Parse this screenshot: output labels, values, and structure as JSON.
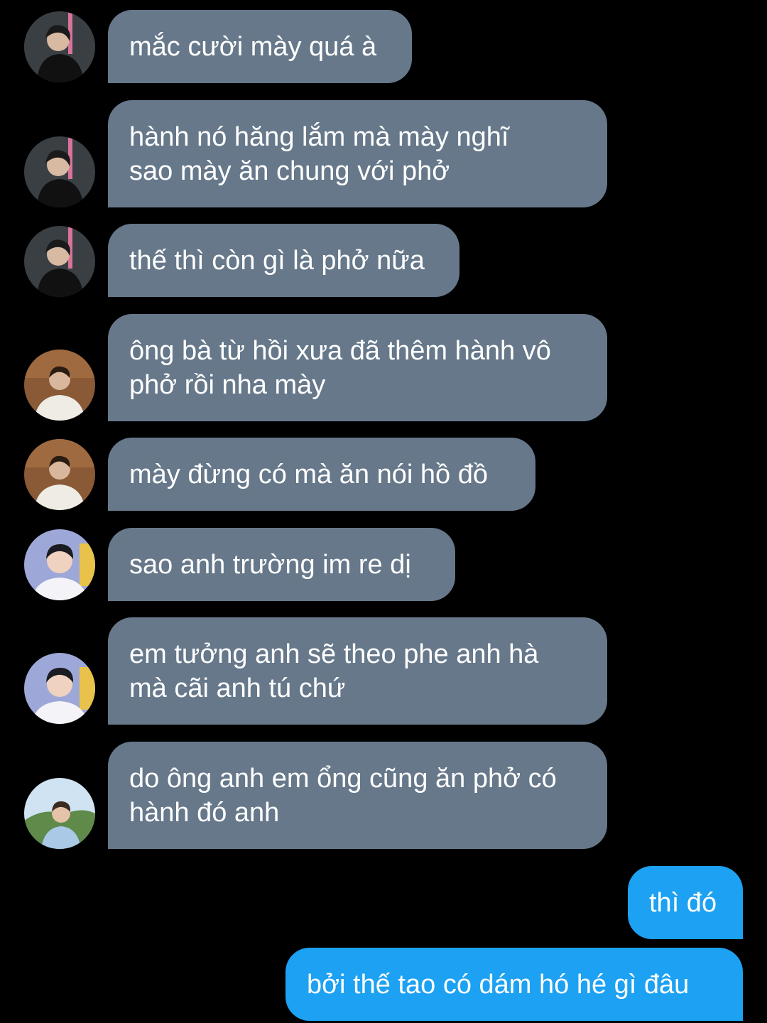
{
  "messages": [
    {
      "sender": "user-a",
      "lines": [
        "mắc cười mày quá à"
      ]
    },
    {
      "sender": "user-a",
      "lines": [
        "hành nó hăng lắm mà mày nghĩ",
        "sao mày ăn chung với phở"
      ]
    },
    {
      "sender": "user-a",
      "lines": [
        "thế thì còn gì là phở nữa"
      ]
    },
    {
      "sender": "user-b",
      "lines": [
        "ông bà từ hồi xưa đã thêm hành vô",
        "phở rồi nha mày"
      ]
    },
    {
      "sender": "user-b",
      "lines": [
        "mày đừng có mà ăn nói hồ đồ"
      ]
    },
    {
      "sender": "user-c",
      "lines": [
        "sao anh trường im re dị"
      ]
    },
    {
      "sender": "user-c",
      "lines": [
        "em tưởng anh sẽ theo phe anh hà",
        "mà cãi anh tú chứ"
      ]
    },
    {
      "sender": "user-d",
      "lines": [
        "do ông anh em ổng cũng ăn phở có",
        "hành đó anh"
      ]
    },
    {
      "sender": "me",
      "lines": [
        "thì đó"
      ]
    },
    {
      "sender": "me",
      "lines": [
        "bởi thế tao có dám hó hé gì đâu"
      ]
    }
  ],
  "colors": {
    "background": "#000000",
    "incoming_bubble": "#66788a",
    "outgoing_bubble": "#1da1f2",
    "text": "#ffffff"
  }
}
